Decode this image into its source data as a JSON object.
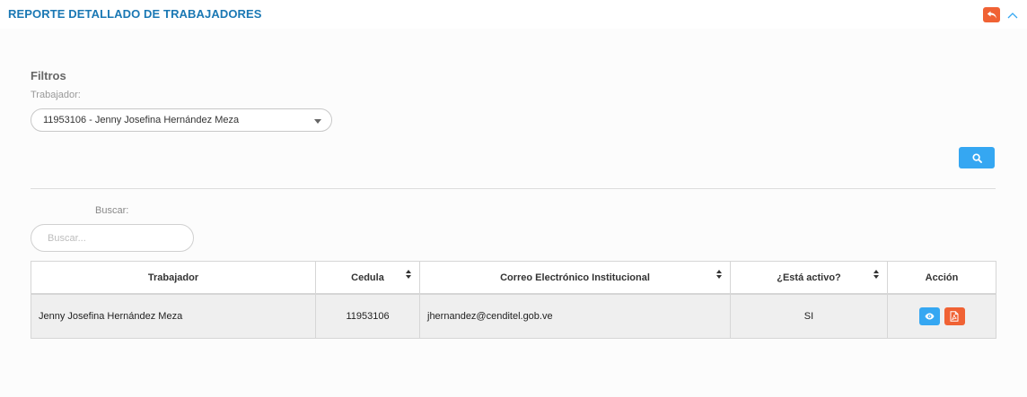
{
  "header": {
    "title": "REPORTE DETALLADO DE TRABAJADORES",
    "back_icon": "undo-icon",
    "collapse_icon": "chevron-up-icon",
    "colors": {
      "title": "#1a78b4",
      "back_button": "#f06234"
    }
  },
  "filters": {
    "title": "Filtros",
    "worker_label": "Trabajador:",
    "worker_selected": "11953106 - Jenny Josefina Hernández Meza",
    "search_button_icon": "search-icon",
    "colors": {
      "search_button": "#35a7f2"
    }
  },
  "table_search": {
    "label": "Buscar:",
    "placeholder": "Buscar..."
  },
  "table": {
    "columns": [
      {
        "label": "Trabajador",
        "sortable": false
      },
      {
        "label": "Cedula",
        "sortable": true
      },
      {
        "label": "Correo Electrónico Institucional",
        "sortable": true
      },
      {
        "label": "¿Está activo?",
        "sortable": true
      },
      {
        "label": "Acción",
        "sortable": false
      }
    ],
    "rows": [
      {
        "trabajador": "Jenny Josefina Hernández Meza",
        "cedula": "11953106",
        "correo": "jhernandez@cenditel.gob.ve",
        "activo": "SI",
        "actions": [
          "eye-icon",
          "pdf-icon"
        ]
      }
    ]
  }
}
